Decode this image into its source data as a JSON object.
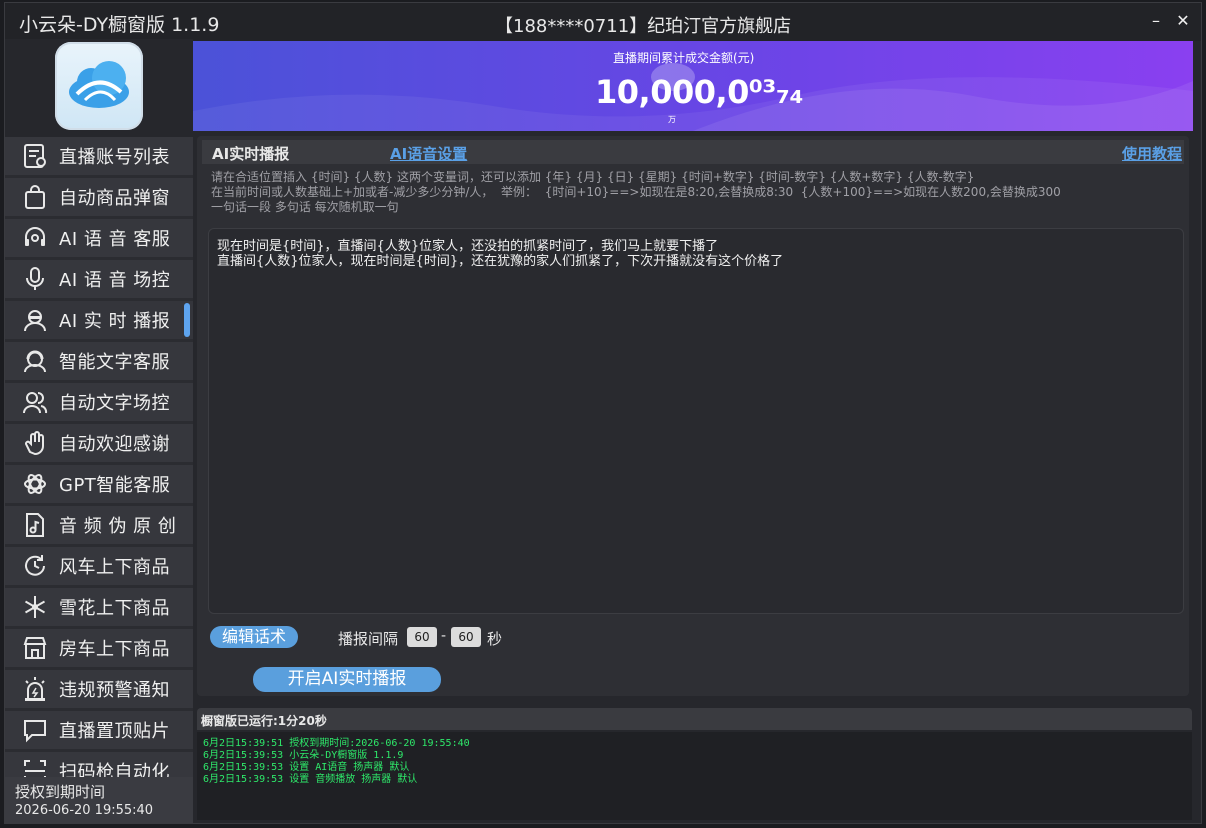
{
  "titlebar": {
    "app_title": "小云朵-DY橱窗版 1.1.9",
    "shop_title": "【188****0711】纪珀汀官方旗舰店",
    "minimize": "–",
    "close": "✕"
  },
  "sidebar": {
    "items": [
      {
        "label": "直播账号列表",
        "icon": "account-list-icon"
      },
      {
        "label": "自动商品弹窗",
        "icon": "shopping-bag-icon"
      },
      {
        "label": "AI 语 音 客服",
        "icon": "headset-icon"
      },
      {
        "label": "AI 语 音 场控",
        "icon": "microphone-icon"
      },
      {
        "label": "AI 实 时 播报",
        "icon": "broadcaster-icon"
      },
      {
        "label": "智能文字客服",
        "icon": "support-agent-icon"
      },
      {
        "label": "自动文字场控",
        "icon": "users-icon"
      },
      {
        "label": "自动欢迎感谢",
        "icon": "wave-hand-icon"
      },
      {
        "label": "GPT智能客服",
        "icon": "openai-icon"
      },
      {
        "label": "音 频 伪 原 创",
        "icon": "music-file-icon"
      },
      {
        "label": "风车上下商品",
        "icon": "clock-cycle-icon"
      },
      {
        "label": "雪花上下商品",
        "icon": "snowflake-icon"
      },
      {
        "label": "房车上下商品",
        "icon": "store-icon"
      },
      {
        "label": "违规预警通知",
        "icon": "alarm-icon"
      },
      {
        "label": "直播置顶贴片",
        "icon": "chat-bubble-icon"
      },
      {
        "label": "扫码枪自动化",
        "icon": "scan-icon"
      }
    ],
    "active_index": 4,
    "expiry_label": "授权到期时间",
    "expiry_value": "2026-06-20 19:55:40"
  },
  "banner": {
    "caption": "直播期间累计成交金额(元)",
    "amount": "10,000,0⁰³₇₄",
    "unit": "万"
  },
  "panel": {
    "tab_title": "AI实时播报",
    "tab_voice_settings": "AI语音设置",
    "tab_help": "使用教程",
    "hint_line1": "请在合适位置插入 {时间} {人数} 这两个变量词，还可以添加 {年} {月} {日} {星期} {时间+数字} {时间-数字} {人数+数字} {人数-数字}",
    "hint_line2": "在当前时间或人数基础上+加或者-减少多少分钟/人，  举例：  {时间+10}==>如现在是8:20,会替换成8:30  {人数+100}==>如现在人数200,会替换成300",
    "hint_line3": "一句话一段 多句话 每次随机取一句",
    "script_lines": [
      "现在时间是{时间}，直播间{人数}位家人，还没拍的抓紧时间了，我们马上就要下播了",
      "直播间{人数}位家人，现在时间是{时间}，还在犹豫的家人们抓紧了，下次开播就没有这个价格了"
    ],
    "edit_button": "编辑话术",
    "interval_label": "播报间隔",
    "interval_min": "60",
    "interval_dash": "-",
    "interval_max": "60",
    "interval_unit": "秒",
    "start_button": "开启AI实时播报"
  },
  "log": {
    "title": "橱窗版已运行:1分20秒",
    "lines": [
      "6月2日15:39:51 授权到期时间:2026-06-20 19:55:40",
      "6月2日15:39:53 小云朵-DY橱窗版 1.1.9",
      "6月2日15:39:53 设置 AI语音 扬声器 默认",
      "6月2日15:39:53 设置 音频播放 扬声器 默认"
    ]
  },
  "colors": {
    "accent": "#5a9fdd",
    "log_text": "#2ee86a",
    "banner_start": "#4b52d8",
    "banner_end": "#8a40f0"
  }
}
